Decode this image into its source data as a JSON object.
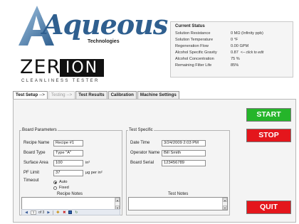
{
  "brand": {
    "name": "Aqueous",
    "sub": "Technologies",
    "product_left": "ZER",
    "product_right": "ION",
    "tagline": "CLEANLINESS TESTER"
  },
  "status": {
    "title": "Current Status",
    "rows": [
      {
        "label": "Solution Resistance",
        "value": "0 MΩ  (Infinity ppb)"
      },
      {
        "label": "Solution Temperature",
        "value": "0 °F"
      },
      {
        "label": "Regeneration Flow",
        "value": "0.00 GPM"
      },
      {
        "label": "Alcohol Specific Gravity",
        "value": "0.87",
        "note": "<-- click to edit"
      },
      {
        "label": "Alcohol Concentration",
        "value": "75 %"
      },
      {
        "label": "Remaining Filter Life",
        "value": "85%"
      }
    ]
  },
  "tabs": [
    {
      "label": "Test Setup",
      "arrow": "-->",
      "state": "active"
    },
    {
      "label": "Testing",
      "arrow": "-->",
      "state": "disabled"
    },
    {
      "label": "Test Results",
      "arrow": "",
      "state": "normal"
    },
    {
      "label": "Calibration",
      "arrow": "",
      "state": "normal"
    },
    {
      "label": "Machine Settings",
      "arrow": "",
      "state": "normal"
    }
  ],
  "board": {
    "legend": "Board Parameters",
    "recipe_name_label": "Recipe Name",
    "recipe_name": "Recipe #1",
    "board_type_label": "Board Type",
    "board_type": "Type \"A\"",
    "surface_area_label": "Surface Area",
    "surface_area": "100",
    "surface_area_unit": "in²",
    "pf_limit_label": "PF Limit",
    "pf_limit": "37",
    "pf_limit_unit": "µg per in²",
    "timeout_label": "Timeout",
    "timeout_auto": "Auto",
    "timeout_fixed": "Fixed",
    "notes_label": "Recipe Notes",
    "nav_position": "1",
    "nav_total": "of 3"
  },
  "test": {
    "legend": "Test Specific",
    "date_time_label": "Date Time",
    "date_time": "3/24/2009 2:03 PM",
    "operator_label": "Operator Name",
    "operator": "Bill Smith",
    "serial_label": "Board Serial",
    "serial": "123456789",
    "notes_label": "Test Notes"
  },
  "buttons": {
    "start": "START",
    "stop": "STOP",
    "quit": "QUIT"
  },
  "colors": {
    "start": "#25b52a",
    "stop": "#e4161c",
    "quit": "#e4161c",
    "logo_blue": "#2f5f8f"
  }
}
